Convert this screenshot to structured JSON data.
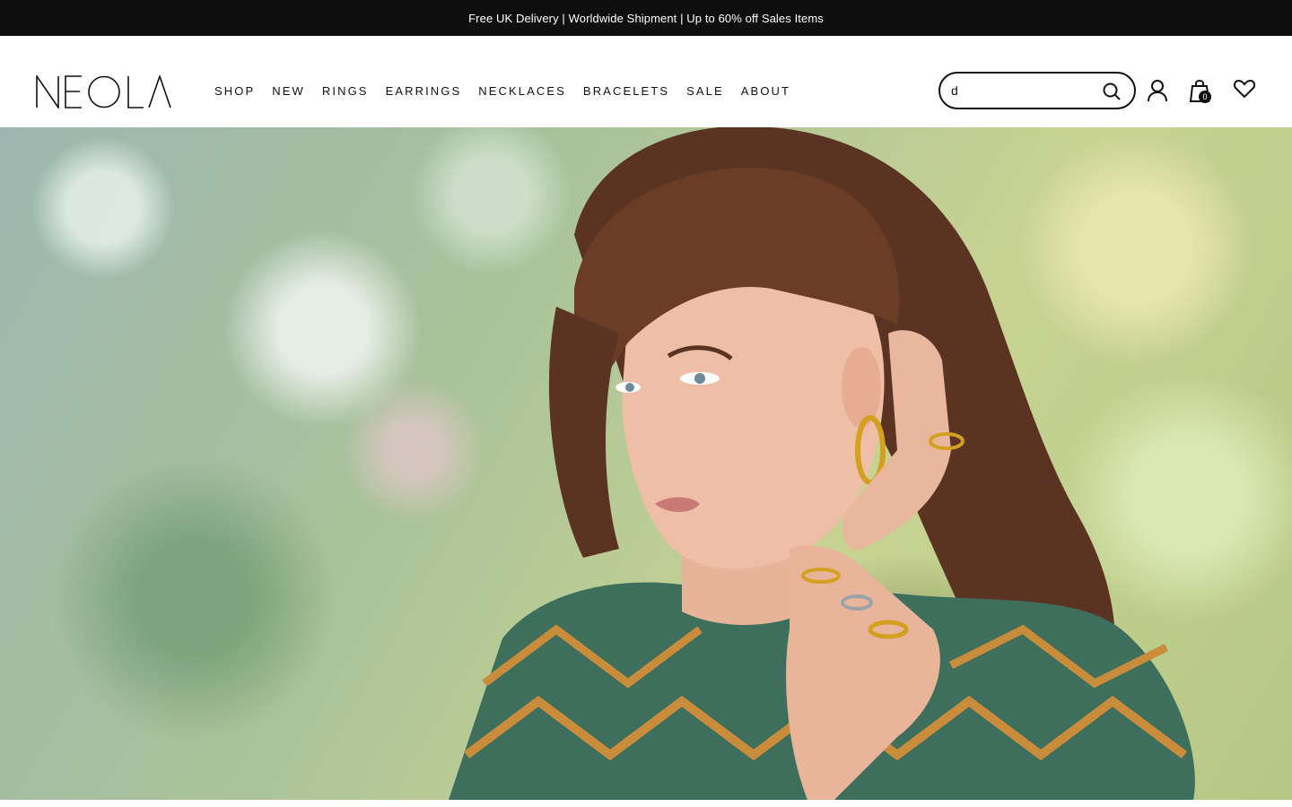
{
  "announcement": {
    "text": "Free UK Delivery | Worldwide Shipment | Up to 60% off Sales Items"
  },
  "logo": {
    "text": "NEOLA"
  },
  "nav": {
    "items": [
      {
        "label": "SHOP"
      },
      {
        "label": "NEW"
      },
      {
        "label": "RINGS"
      },
      {
        "label": "EARRINGS"
      },
      {
        "label": "NECKLACES"
      },
      {
        "label": "BRACELETS"
      },
      {
        "label": "SALE"
      },
      {
        "label": "ABOUT"
      }
    ]
  },
  "search": {
    "value": "d",
    "icon": "search-icon"
  },
  "header_icons": {
    "account": "user-icon",
    "bag": "shopping-bag-icon",
    "bag_count": "0",
    "wishlist": "heart-icon"
  },
  "hero": {
    "image": "woman-wearing-gold-jewellery-photo"
  }
}
